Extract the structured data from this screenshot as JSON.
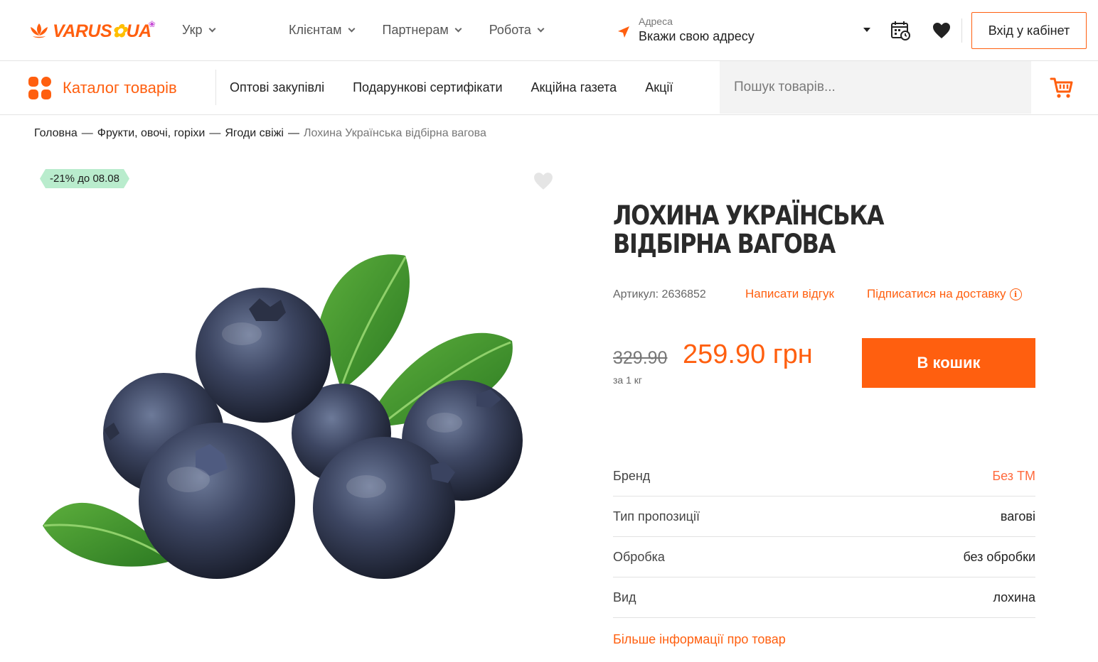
{
  "brand": {
    "logo_text": "VARUS",
    "logo_ua": "UA",
    "accent": "#ff5f0f"
  },
  "header": {
    "lang": "Укр",
    "nav": [
      {
        "label": "Клієнтам"
      },
      {
        "label": "Партнерам"
      },
      {
        "label": "Робота"
      }
    ],
    "address_label": "Адреса",
    "address_value": "Вкажи свою адресу",
    "icons": [
      "location-arrow-icon",
      "calendar-icon",
      "heart-icon"
    ],
    "login": "Вхід у кабінет"
  },
  "navbar": {
    "catalog": "Каталог товарів",
    "links": [
      "Оптові закупівлі",
      "Подарункові сертифікати",
      "Акційна газета",
      "Акції"
    ],
    "search_placeholder": "Пошук товарів...",
    "cart_icon": "cart-icon"
  },
  "breadcrumb": {
    "items": [
      "Головна",
      "Фрукти, овочі, горіхи",
      "Ягоди свіжі"
    ],
    "current": "Лохина Українська відбірна вагова",
    "separator": "—"
  },
  "product": {
    "badge": "-21% до 08.08",
    "badge_color": "#b9eccd",
    "title": "ЛОХИНА УКРАЇНСЬКА ВІДБІРНА ВАГОВА",
    "sku": "Артикул: 2636852",
    "review_link": "Написати відгук",
    "subscribe_link": "Підписатися на доставку",
    "old_price": "329.90",
    "new_price": "259.90 грн",
    "unit": "за 1 кг",
    "buy_button": "В кошик",
    "attributes": [
      {
        "key": "Бренд",
        "value": "Без ТМ",
        "is_link": true
      },
      {
        "key": "Тип пропозиції",
        "value": "вагові"
      },
      {
        "key": "Обробка",
        "value": "без обробки"
      },
      {
        "key": "Вид",
        "value": "лохина"
      }
    ],
    "more_info": "Більше інформації про товар",
    "image": "blueberries-with-leaves"
  }
}
